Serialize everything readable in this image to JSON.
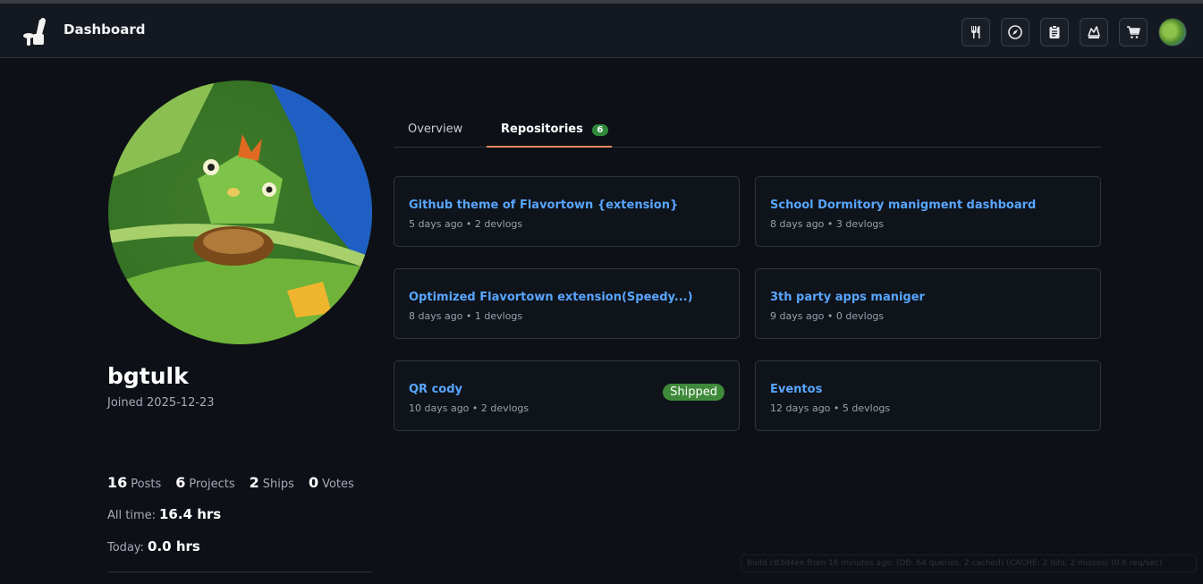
{
  "header": {
    "brand": "Dashboard",
    "buttons": [
      "utensils-icon",
      "compass-icon",
      "clipboard-icon",
      "chef-hat-icon",
      "cart-icon"
    ]
  },
  "profile": {
    "username": "bgtulk",
    "joined": "Joined 2025-12-23",
    "stats": [
      {
        "num": "16",
        "label": "Posts"
      },
      {
        "num": "6",
        "label": "Projects"
      },
      {
        "num": "2",
        "label": "Ships"
      },
      {
        "num": "0",
        "label": "Votes"
      }
    ],
    "all_time_label": "All time:",
    "all_time_value": "16.4 hrs",
    "today_label": "Today:",
    "today_value": "0.0 hrs"
  },
  "tabs": {
    "overview": "Overview",
    "repositories": "Repositories",
    "repositories_count": "6"
  },
  "repos": [
    {
      "title": "Github theme of Flavortown {extension}",
      "meta": "5 days ago • 2 devlogs",
      "badge": ""
    },
    {
      "title": "School Dormitory manigment dashboard",
      "meta": "8 days ago • 3 devlogs",
      "badge": ""
    },
    {
      "title": "Optimized Flavortown extension(Speedy...)",
      "meta": "8 days ago • 1 devlogs",
      "badge": ""
    },
    {
      "title": "3th party apps maniger",
      "meta": "9 days ago • 0 devlogs",
      "badge": ""
    },
    {
      "title": "QR cody",
      "meta": "10 days ago • 2 devlogs",
      "badge": "Shipped"
    },
    {
      "title": "Eventos",
      "meta": "12 days ago • 5 devlogs",
      "badge": ""
    }
  ],
  "footer_note": "Build c83d4ee from 16 minutes ago. (DB: 64 queries, 2 cached) (CACHE: 2 hits, 2 misses) (0.6 req/sec)",
  "colors": {
    "background": "#0d1017",
    "link": "#58a6ff",
    "tab_accent": "#f08a5d",
    "badge_green": "#2f8a3b",
    "shipped_green": "#3f8a3a"
  }
}
